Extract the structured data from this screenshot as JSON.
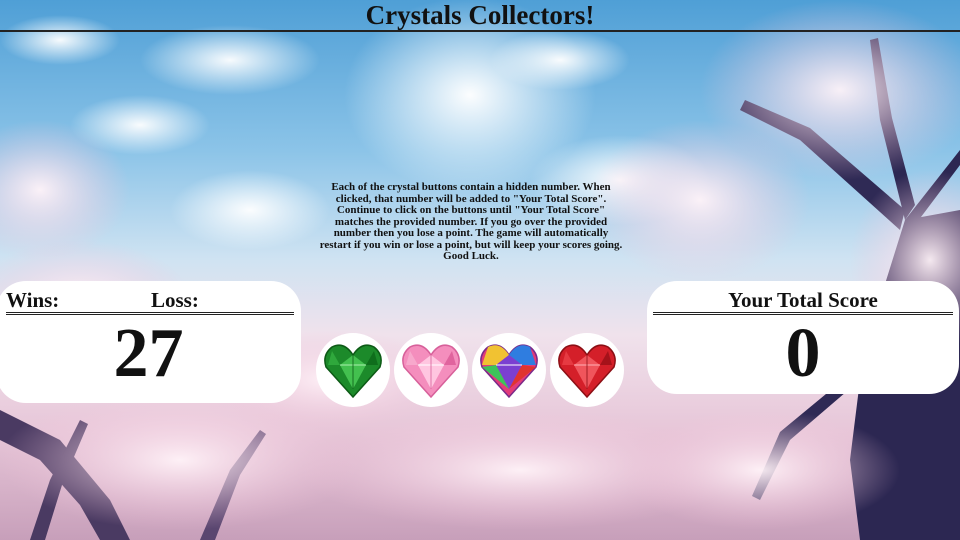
{
  "game": {
    "title": "Crystals Collectors!",
    "instructions": "Each of the crystal buttons contain a hidden number. When clicked, that number will be added to \"Your Total Score\". Continue to click on the buttons until \"Your Total Score\" matches the provided number. If you go over the provided number then you lose a point. The game will automatically restart if you win or lose a point, but will keep your scores going. Good Luck."
  },
  "scoreboard": {
    "wins_label": "Wins:",
    "loss_label": "Loss:",
    "target_number": "27"
  },
  "total": {
    "label": "Your Total Score",
    "value": "0"
  },
  "crystals": [
    {
      "name": "green-heart-crystal",
      "color": "#1f9a2f"
    },
    {
      "name": "pink-heart-crystal",
      "color": "#f28ab8"
    },
    {
      "name": "rainbow-heart-crystal",
      "color": "#e23b7a"
    },
    {
      "name": "red-heart-crystal",
      "color": "#d8202a"
    }
  ]
}
